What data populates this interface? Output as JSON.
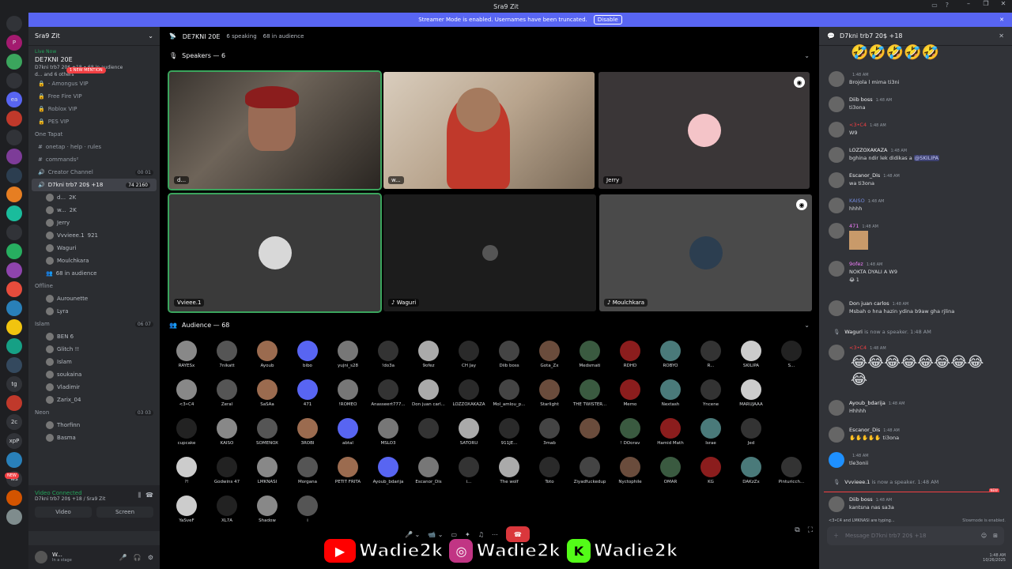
{
  "window": {
    "title": "Sra9 Zit",
    "controls": [
      "–",
      "❐",
      "✕"
    ]
  },
  "banner": {
    "text": "Streamer Mode is enabled. Usernames have been truncated.",
    "disable_label": "Disable"
  },
  "guilds": {
    "items": [
      "",
      "P",
      "",
      "",
      "ea",
      "",
      "",
      "",
      "",
      "",
      "",
      "",
      "",
      "",
      "",
      "",
      "",
      "",
      "",
      "tg",
      "",
      "2c",
      "xpP",
      "",
      "ws",
      "",
      ""
    ],
    "new_label": "NEW"
  },
  "server": {
    "name": "Sra9 Zit",
    "live": {
      "badge": "Live Now",
      "title": "DE7KNI 20E",
      "sub1": "D7kni trb7 20$ +18 • 68 in audience",
      "sub2": "d... and 6 others"
    },
    "new_mention": "1 NEW MENTION",
    "channels_top": [
      {
        "icon": "🔒",
        "label": "- Amongus VIP"
      },
      {
        "icon": "🔒",
        "label": "Free Fire VIP"
      },
      {
        "icon": "🔒",
        "label": "Roblox VIP"
      },
      {
        "icon": "🔒",
        "label": "PES VIP"
      }
    ],
    "category_onetap": "One Tapat",
    "channels_mid": [
      {
        "icon": "#",
        "label": "onetap · help · rules"
      },
      {
        "icon": "#",
        "label": "commands²"
      },
      {
        "icon": "🔊",
        "label": "Creator Channel",
        "count": "00 01"
      }
    ],
    "active_channel": {
      "label": "D7kni trb7 20$ +18",
      "sub": "DE7KNI 20E",
      "count": "74  2160"
    },
    "voice_users": [
      {
        "name": "d...",
        "tag": "2K"
      },
      {
        "name": "w...",
        "tag": "2K"
      },
      {
        "name": "Jerry",
        "tag": ""
      },
      {
        "name": "Vvvieee.1",
        "tag": "921"
      },
      {
        "name": "Waguri",
        "tag": ""
      },
      {
        "name": "Moulchkara",
        "tag": ""
      }
    ],
    "in_audience": "68 in audience",
    "offline_label": "Offline",
    "offline_users": [
      "Aurounette",
      "Lyra"
    ],
    "category_islam": "Islam",
    "islam_count": "06 07",
    "islam_users": [
      "BEN 6",
      "Glitch !!",
      "Islam",
      "soukaina",
      "Vladimir",
      "Zarix_04"
    ],
    "category_neon": "Neon",
    "neon_count": "03 03",
    "neon_users": [
      "Thorfinn",
      "Basma"
    ]
  },
  "voice_panel": {
    "status": "Video Connected",
    "sub": "D7kni trb7 20$ +18 / Sra9 Zit",
    "video_label": "Video",
    "screen_label": "Screen"
  },
  "user": {
    "name": "W...",
    "status": "In a stage"
  },
  "stage": {
    "title": "DE7KNI 20E",
    "speaking": "6 speaking",
    "audience_count": "68 in audience",
    "speakers_title": "Speakers — 6",
    "audience_title": "Audience — 68",
    "tiles": [
      {
        "label": "d..."
      },
      {
        "label": "w..."
      },
      {
        "label": "Jerry"
      },
      {
        "label": "Vvieee.1"
      },
      {
        "label": "Waguri"
      },
      {
        "label": "Moulchkara"
      }
    ],
    "audience": [
      "RAYESx",
      "7nikatt",
      "Ayoub",
      "bibo",
      "yujni_s28",
      "!do3a",
      "9ofez",
      "CH Jay",
      "Diib boss",
      "Gota_Zx",
      "Medsmati",
      "RDHD",
      "ROBYO",
      "R...",
      "SKILIPA",
      "S...",
      "<3•C4",
      "Zeral",
      "SaSAa",
      "471",
      "!ROMEO",
      "Anasseert777...",
      "Don juan carl...",
      "LOZZOXAKAZA",
      "Mol_amlou_p...",
      "Starlight",
      "THE TWISTER...",
      "Memo",
      "Nextash",
      "Yncene",
      "MARUJAAA",
      "cupcake",
      "KAISO",
      "SOMENOX",
      "3ROBI",
      "abtal",
      "MSLO3",
      "",
      "SATORU",
      "911JE...",
      "3mab",
      "",
      "! DOorav",
      "Hamid Math",
      "Israe",
      "Jed",
      "?!",
      "Godwins 47",
      "LMKNASI",
      "Morgana",
      "PETIT FRITA",
      "Ayoub_bdarija",
      "Escanor_Dis",
      "i...",
      "The wolf",
      "Toto",
      "Ziyadfuckedup",
      "Nyctophile",
      "OMAR",
      "KG",
      "DAKzZx",
      "Pinturicch...",
      "YaSveF",
      "XL7A",
      "Shadow",
      "i"
    ]
  },
  "chat": {
    "title": "D7kni trb7 20$ +18",
    "messages": [
      {
        "emoji": "🤣🤣🤣🤣🤣"
      },
      {
        "name": "",
        "time": "1:48 AM",
        "text": "Brojola l mima ti3ni"
      },
      {
        "name": "Diib boss",
        "time": "1:48 AM",
        "text": "ti3ona"
      },
      {
        "name": "<3•C4",
        "time": "1:48 AM",
        "text": "W9"
      },
      {
        "name": "LOZZOXAKAZA",
        "time": "1:48 AM",
        "text_a": "bghina ndir lek didikas a ",
        "mention": "@SKILIPA"
      },
      {
        "name": "Escanor_Dis",
        "time": "1:48 AM",
        "text": "wa ti3ona"
      },
      {
        "name": "KAISO",
        "time": "1:48 AM",
        "text": "hhhh"
      },
      {
        "name": "471",
        "time": "1:48 AM",
        "text": ""
      },
      {
        "name": "9ofez",
        "time": "1:48 AM",
        "text": "NOKTA DYALI A W9"
      },
      {
        "name": "Don juan carlos",
        "time": "1:48 AM",
        "text": "Msbah o hna hazin ydina b9aw gha rjlina"
      },
      {
        "name": "<3•C4",
        "time": "1:48 AM",
        "emoji": "😂😂😂😂😂😂😂😂😂"
      },
      {
        "name": "Ayoub_bdarija",
        "time": "1:48 AM",
        "text": "Hhhhh"
      },
      {
        "name": "Escanor_Dis",
        "time": "1:48 AM",
        "text": "✋✋✋✋✋ ti3ona"
      },
      {
        "name": "",
        "time": "1:48 AM",
        "text": "tle3onii"
      },
      {
        "name": "Diib boss",
        "time": "1:48 AM",
        "text": "kantsna nas sa3a"
      }
    ],
    "reaction": "1",
    "system_waguri": {
      "name": "Waguri",
      "text": "is now a speaker.",
      "time": "1:48 AM"
    },
    "system_vvieee": {
      "name": "Vvvieee.1",
      "text": "is now a speaker.",
      "time": "1:48 AM"
    },
    "new_label": "NEW",
    "typing": "<3•C4 and LMKNASI are typing...",
    "slowmode": "Slowmode is enabled.",
    "input_placeholder": "Message D7kni trb7 20$ +18",
    "clock": "1:48 AM",
    "date": "10/26/2025"
  },
  "social": {
    "youtube": "Wadie2k",
    "instagram": "Wadie2k",
    "kick": "Wadie2k"
  },
  "colors": {
    "accent": "#5865f2",
    "green": "#23a55a",
    "red": "#f23f43",
    "bg_dark": "#1e1f22",
    "bg_sidebar": "#2b2d31",
    "bg_chat": "#313338"
  }
}
